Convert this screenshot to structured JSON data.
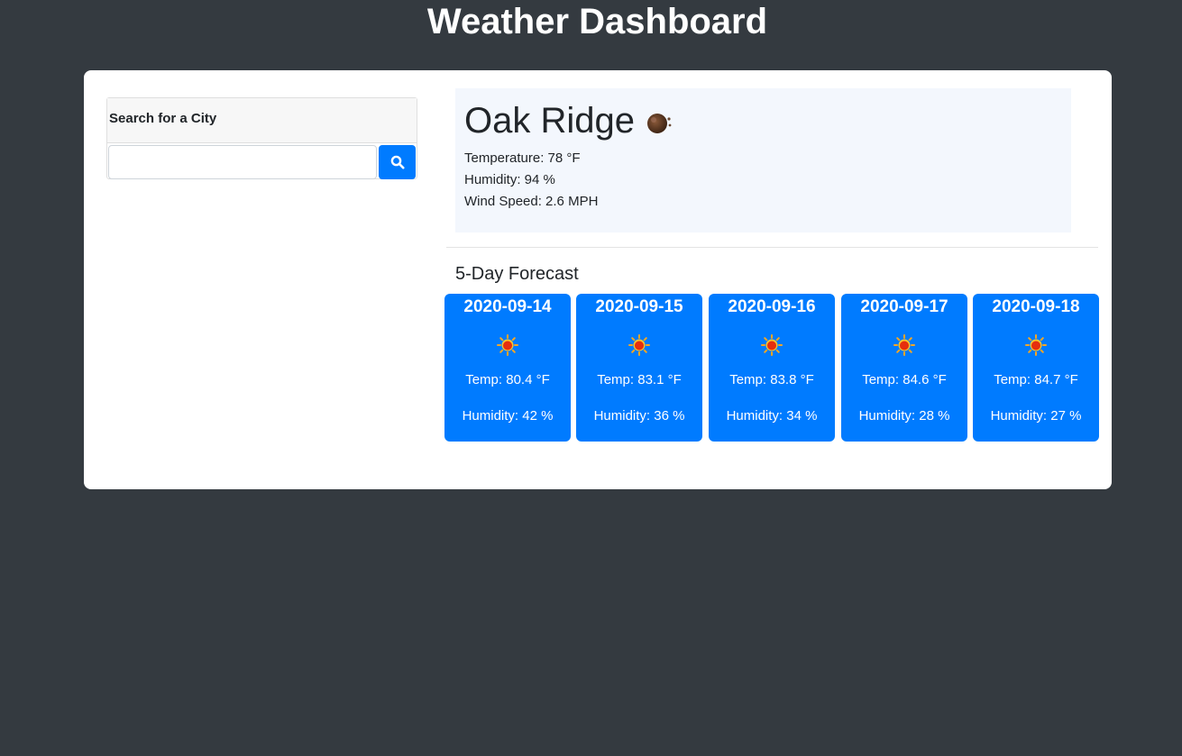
{
  "header": {
    "title": "Weather Dashboard"
  },
  "search": {
    "heading": "Search for a City",
    "input_value": "",
    "placeholder": "",
    "button_icon": "search-icon"
  },
  "current": {
    "city": "Oak Ridge",
    "condition_icon": "moon-clear-night-icon",
    "temperature": "Temperature: 78 °F",
    "humidity": "Humidity: 94 %",
    "wind_speed": "Wind Speed: 2.6 MPH"
  },
  "forecast": {
    "heading": "5-Day Forecast",
    "days": [
      {
        "date": "2020-09-14",
        "icon": "sun-icon",
        "temp": "Temp: 80.4 °F",
        "humidity": "Humidity: 42 %"
      },
      {
        "date": "2020-09-15",
        "icon": "sun-icon",
        "temp": "Temp: 83.1 °F",
        "humidity": "Humidity: 36 %"
      },
      {
        "date": "2020-09-16",
        "icon": "sun-icon",
        "temp": "Temp: 83.8 °F",
        "humidity": "Humidity: 34 %"
      },
      {
        "date": "2020-09-17",
        "icon": "sun-icon",
        "temp": "Temp: 84.6 °F",
        "humidity": "Humidity: 28 %"
      },
      {
        "date": "2020-09-18",
        "icon": "sun-icon",
        "temp": "Temp: 84.7 °F",
        "humidity": "Humidity: 27 %"
      }
    ]
  },
  "colors": {
    "page_background": "#343a40",
    "card_background": "#ffffff",
    "accent_blue": "#007bff",
    "current_panel_background": "#f3f7fd"
  }
}
